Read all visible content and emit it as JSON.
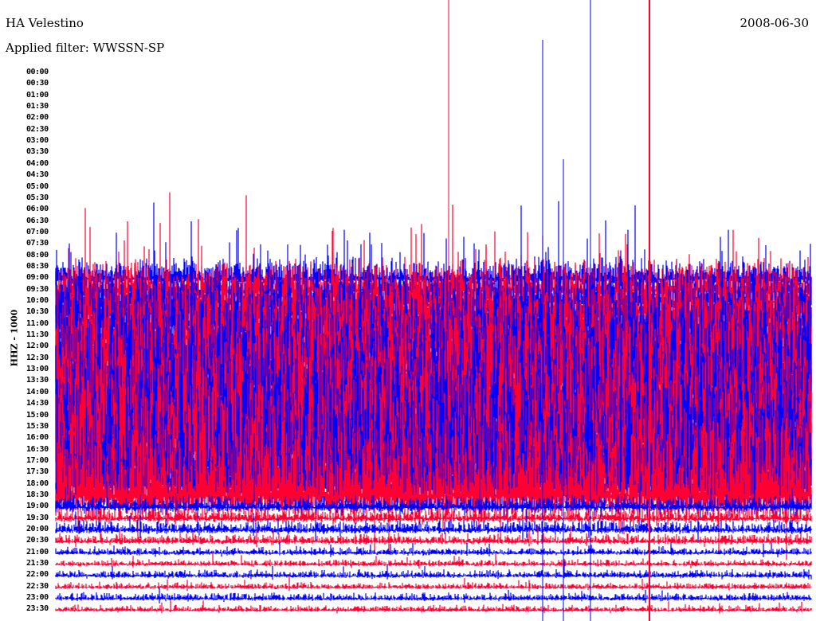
{
  "header": {
    "station": "HA Velestino",
    "filter": "Applied filter: WWSSN-SP",
    "date": "2008-06-30",
    "channel": "HHZ - 1000"
  },
  "chart_data": {
    "type": "line",
    "title": "HA Velestino",
    "subtitle": "Applied filter: WWSSN-SP",
    "ylabel": "HHZ - 1000",
    "row_labels": [
      "00:00",
      "00:30",
      "01:00",
      "01:30",
      "02:00",
      "02:30",
      "03:00",
      "03:30",
      "04:00",
      "04:30",
      "05:00",
      "05:30",
      "06:00",
      "06:30",
      "07:00",
      "07:30",
      "08:00",
      "08:30",
      "09:00",
      "09:30",
      "10:00",
      "10:30",
      "11:00",
      "11:30",
      "12:00",
      "12:30",
      "13:00",
      "13:30",
      "14:00",
      "14:30",
      "15:00",
      "15:30",
      "16:00",
      "16:30",
      "17:00",
      "17:30",
      "18:00",
      "18:30",
      "19:00",
      "19:30",
      "20:00",
      "20:30",
      "21:00",
      "21:30",
      "22:00",
      "22:30",
      "23:00",
      "23:30"
    ],
    "series_colors": [
      "#0000ff",
      "#ff0033"
    ],
    "relative_amplitude_rows": [
      0,
      0,
      0,
      0,
      0,
      0,
      0,
      0,
      0,
      0,
      0,
      0,
      0,
      0,
      0,
      0,
      0,
      0,
      2,
      3,
      4,
      5,
      5,
      6,
      6,
      7,
      7,
      8,
      8,
      8,
      8,
      9,
      9,
      9,
      9,
      9,
      9,
      8,
      1.2,
      1.0,
      1.0,
      0.8,
      0.6,
      0.5,
      0.6,
      0.5,
      0.6,
      0.5
    ]
  }
}
